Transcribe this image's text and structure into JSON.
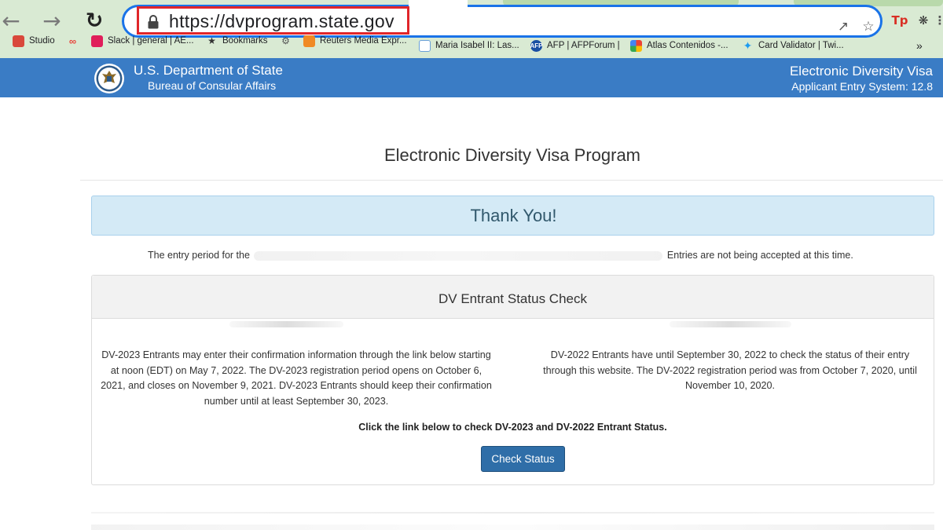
{
  "browser": {
    "url": "https://dvprogram.state.gov",
    "bookmarks": [
      {
        "label": "Studio",
        "icon": "studio-icon"
      },
      {
        "label": "Slack | general | AE...",
        "icon": "slack-icon"
      },
      {
        "label": "Bookmarks",
        "icon": "star-icon"
      },
      {
        "label": "Reuters Media Expr...",
        "icon": "reuters-icon"
      },
      {
        "label": "Maria Isabel II: Las...",
        "icon": "doc-icon"
      },
      {
        "label": "AFP | AFPForum |",
        "icon": "afp-icon"
      },
      {
        "label": "Atlas Contenidos -...",
        "icon": "atlas-icon"
      },
      {
        "label": "Card Validator | Twi...",
        "icon": "twitter-icon"
      }
    ],
    "more_bookmarks": "»",
    "extension_label": "Tp"
  },
  "header": {
    "dept": "U.S. Department of State",
    "bureau": "Bureau of Consular Affairs",
    "system_title": "Electronic Diversity Visa",
    "system_sub": "Applicant Entry System: 12.8"
  },
  "main": {
    "program_title": "Electronic Diversity Visa Program",
    "thanks": "Thank You!",
    "period_prefix": "The entry period for the",
    "period_suffix": "Entries are not being accepted at this time.",
    "status_title": "DV Entrant Status Check",
    "left_text": "DV-2023 Entrants may enter their confirmation information through the link below starting at noon (EDT) on May 7, 2022. The DV-2023 registration period opens on October 6, 2021, and closes on November 9, 2021. DV-2023 Entrants should keep their confirmation number until at least September 30, 2023.",
    "right_text": "DV-2022 Entrants have until September 30, 2022 to check the status of their entry through this website. The DV-2022 registration period was from October 7, 2020, until November 10, 2020.",
    "click_note": "Click the link below to check DV-2023 and DV-2022 Entrant Status.",
    "check_button": "Check Status"
  },
  "colors": {
    "header_bg": "#3a7cc5",
    "alert_bg": "#d4eaf6",
    "button_bg": "#2f6ea8",
    "url_highlight": "#e0262a",
    "chrome_bg": "#d9ead3"
  }
}
